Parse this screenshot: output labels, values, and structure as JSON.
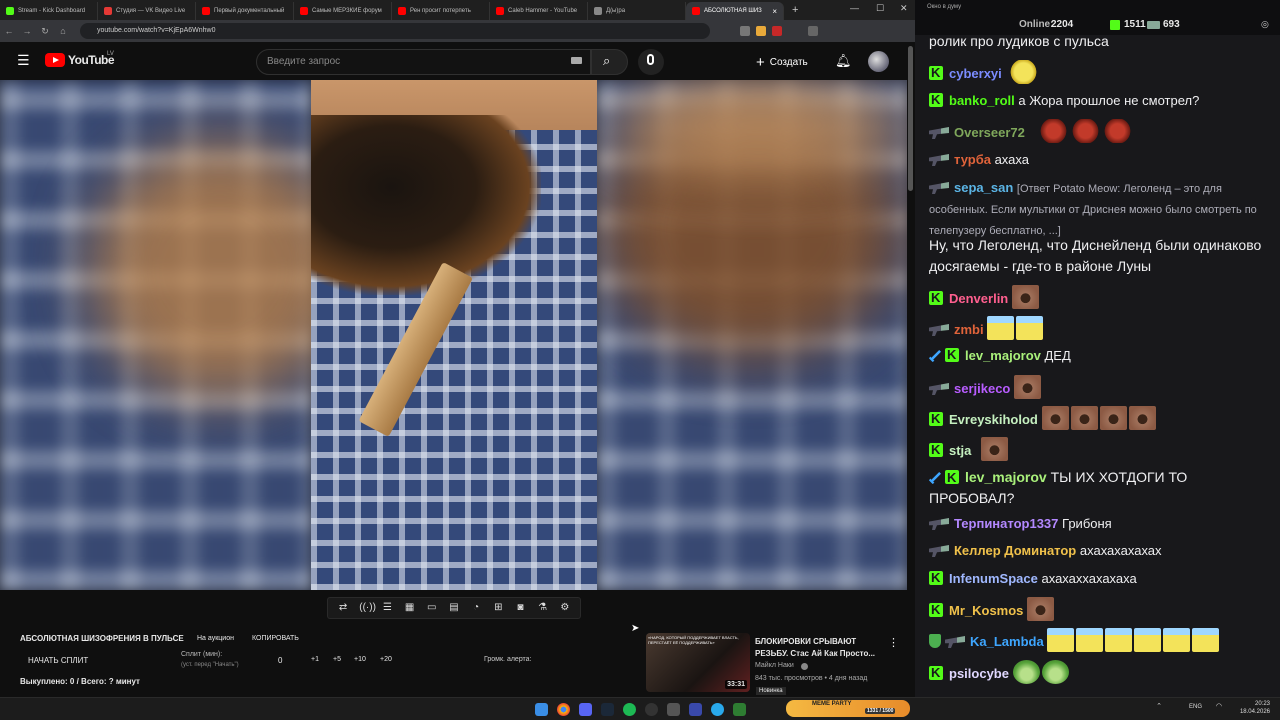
{
  "browser": {
    "tabs": [
      {
        "label": "Stream - Kick Dashboard",
        "color": "#53fc18"
      },
      {
        "label": "Студия — VK Видео Live",
        "color": "#e53935"
      },
      {
        "label": "Первый документальный",
        "color": "#ff0000"
      },
      {
        "label": "Самые МЕРЗКИЕ форум",
        "color": "#ff0000"
      },
      {
        "label": "Рен просит потерпеть",
        "color": "#ff0000"
      },
      {
        "label": "Caleb Hammer - YouTube",
        "color": "#ff0000"
      },
      {
        "label": "Д(ы)ра",
        "color": "#888888"
      },
      {
        "label": "АБСОЛЮТНАЯ ШИЗ",
        "color": "#ff0000",
        "active": true
      }
    ],
    "url": "youtube.com/watch?v=KjEpA6Wnhw0",
    "ext_badge": "216"
  },
  "youtube": {
    "logo_text": "YouTube",
    "region": "LV",
    "search_placeholder": "Введите запрос",
    "create_label": "Создать"
  },
  "panel": {
    "title": "АБСОЛЮТНАЯ ШИЗОФРЕНИЯ В ПУЛЬСЕ",
    "auction_label": "На аукцион",
    "copy_label": "КОПИРОВАТЬ",
    "start_split": "НАЧАТЬ СПЛИТ",
    "split_label": "Сплит (мин):",
    "split_hint": "(уст. перед \"Начать\")",
    "split_value": "0",
    "increments": [
      "+1",
      "+5",
      "+10",
      "+20"
    ],
    "alert_label": "Громк. алерта:",
    "bought": "Выкуплено: 0 / Всего: ? минут"
  },
  "recommendation": {
    "thumb_text": "«НАРОД, КОТОРЫЙ ПОДДЕРЖИВАЕТ ВЛАСТЬ, ПЕРЕСТАЁТ ЕЁ ПОДДЕРЖИВАТЬ»",
    "duration": "33:31",
    "title": "БЛОКИРОВКИ СРЫВАЮТ РЕЗЬБУ. Стас Ай Как Просто...",
    "channel": "Майкл Наки",
    "meta": "843 тыс. просмотров • 4 дня назад",
    "badge": "Новинка"
  },
  "chat": {
    "window_title": "Окно в думу",
    "online_label": "Online:",
    "online_count": "2204",
    "kick_count": "1511",
    "other_count": "693",
    "top_fragment": "ролик про лудиков с пульса",
    "messages": [
      {
        "user": "cyberxyi",
        "color": "#7b8cff",
        "text": ""
      },
      {
        "user": "banko_roll",
        "color": "#53fc18",
        "text": "а Жора прошлое не смотрел?"
      },
      {
        "user": "Overseer72",
        "color": "#7fa75b",
        "text": ""
      },
      {
        "user": "турба",
        "color": "#e0633a",
        "text": "ахаха"
      },
      {
        "user": "sepa_san",
        "color": "#5bb4e5",
        "text": "[Ответ Potato Meow: Леголенд – это для особенных. Если мультики от Дриснея можно было смотреть по телепузеру бесплатно, ...]"
      },
      {
        "user": "",
        "color": "#efeff1",
        "text": "Ну, что Леголенд, что Диснейленд были одинаково досягаемы - где-то в районе Луны"
      },
      {
        "user": "Denverlin",
        "color": "#ff5f8f",
        "text": ""
      },
      {
        "user": "zmbi",
        "color": "#e0633a",
        "text": ""
      },
      {
        "user": "lev_majorov",
        "color": "#a9f07b",
        "text": "ДЕД"
      },
      {
        "user": "serjikeco",
        "color": "#b85cff",
        "text": ""
      },
      {
        "user": "Evreyskiholod",
        "color": "#c5f0c0",
        "text": ""
      },
      {
        "user": "stja",
        "color": "#c5f0c0",
        "text": ""
      },
      {
        "user": "lev_majorov",
        "color": "#a9f07b",
        "text": "ТЫ ИХ ХОТДОГИ ТО ПРОБОВАЛ?"
      },
      {
        "user": "Терпинатор1337",
        "color": "#b388ff",
        "text": "Грибоня"
      },
      {
        "user": "Келлер Доминатор",
        "color": "#f0c14b",
        "text": "ахахахахахах"
      },
      {
        "user": "InfenumSpace",
        "color": "#a0b8ff",
        "text": "ахахаххахахаха"
      },
      {
        "user": "Mr_Kosmos",
        "color": "#f0c14b",
        "text": ""
      },
      {
        "user": "Ka_Lambda",
        "color": "#3ea6ff",
        "text": ""
      },
      {
        "user": "psilocybe",
        "color": "#e0d7ff",
        "text": ""
      }
    ]
  },
  "taskbar": {
    "lang": "ENG",
    "time": "20:23",
    "date": "18.04.2026",
    "meme_party": "MEME PARTY",
    "meme_counter": "1331 / 1500"
  }
}
